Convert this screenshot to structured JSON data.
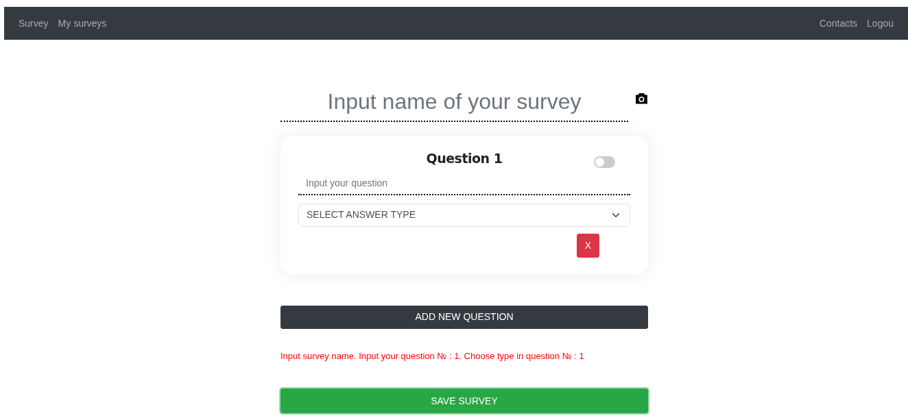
{
  "navbar": {
    "left_links": [
      "Survey",
      "My surveys"
    ],
    "right_links": [
      "Contacts",
      "Logou"
    ]
  },
  "survey_name": {
    "placeholder": "Input name of your survey"
  },
  "questions": [
    {
      "title": "Question 1",
      "enabled": false,
      "question_placeholder": "Input your question",
      "answer_type": "SELECT ANSWER TYPE",
      "delete_label": "X"
    }
  ],
  "add_button": "ADD NEW QUESTION",
  "error_message": "Input survey name. Input your question № : 1. Choose type in question № : 1",
  "save_button": "SAVE SURVEY"
}
